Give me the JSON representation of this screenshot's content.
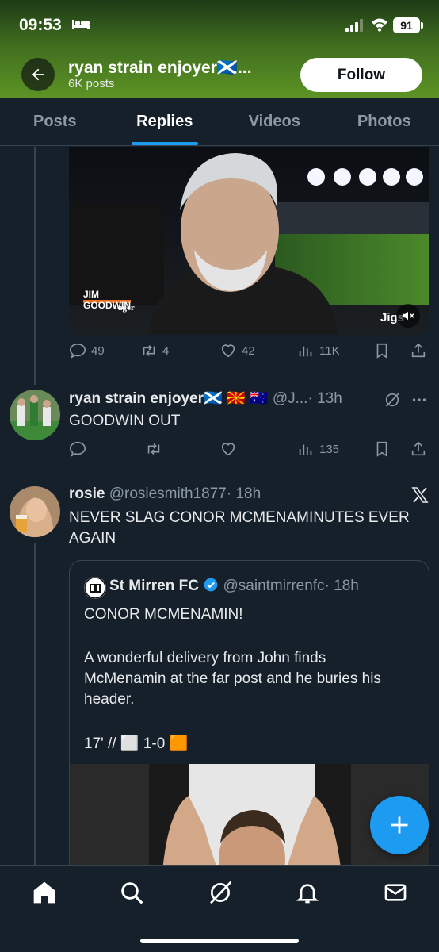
{
  "status_bar": {
    "time": "09:53",
    "battery": "91"
  },
  "header": {
    "profile_name": "ryan strain enjoyer🏴󠁧󠁢󠁳󠁣󠁴󠁿...",
    "post_count": "6K posts",
    "follow_label": "Follow"
  },
  "tabs": [
    {
      "label": "Posts"
    },
    {
      "label": "Replies",
      "active": true
    },
    {
      "label": "Videos"
    },
    {
      "label": "Photos"
    }
  ],
  "tweet1": {
    "video_caption_name": "JIM GOODWIN",
    "video_caption_role": "ager",
    "watermark": "Jigs",
    "replies": "49",
    "retweets": "4",
    "likes": "42",
    "views": "11K"
  },
  "tweet2": {
    "name": "ryan strain enjoyer🏴󠁧󠁢󠁳󠁣󠁴󠁿 🇲🇰 🇦🇺",
    "handle": "@J...",
    "time": "· 13h",
    "text": "GOODWIN OUT",
    "views": "135"
  },
  "tweet3": {
    "name": "rosie",
    "handle": "@rosiesmith1877",
    "time": "· 18h",
    "text": "NEVER SLAG CONOR MCMENAMINUTES EVER AGAIN",
    "quote": {
      "name": "St Mirren FC",
      "handle": "@saintmirrenfc",
      "time": "· 18h",
      "line1": "CONOR MCMENAMIN!",
      "line2": "A wonderful delivery from John finds McMenamin at the far post and he buries his header.",
      "line3": "17' // ⬜ 1-0 🟧"
    }
  },
  "colors": {
    "accent": "#1d9bf0",
    "background": "#15202b",
    "border": "#38444d",
    "muted": "#8b98a5"
  }
}
